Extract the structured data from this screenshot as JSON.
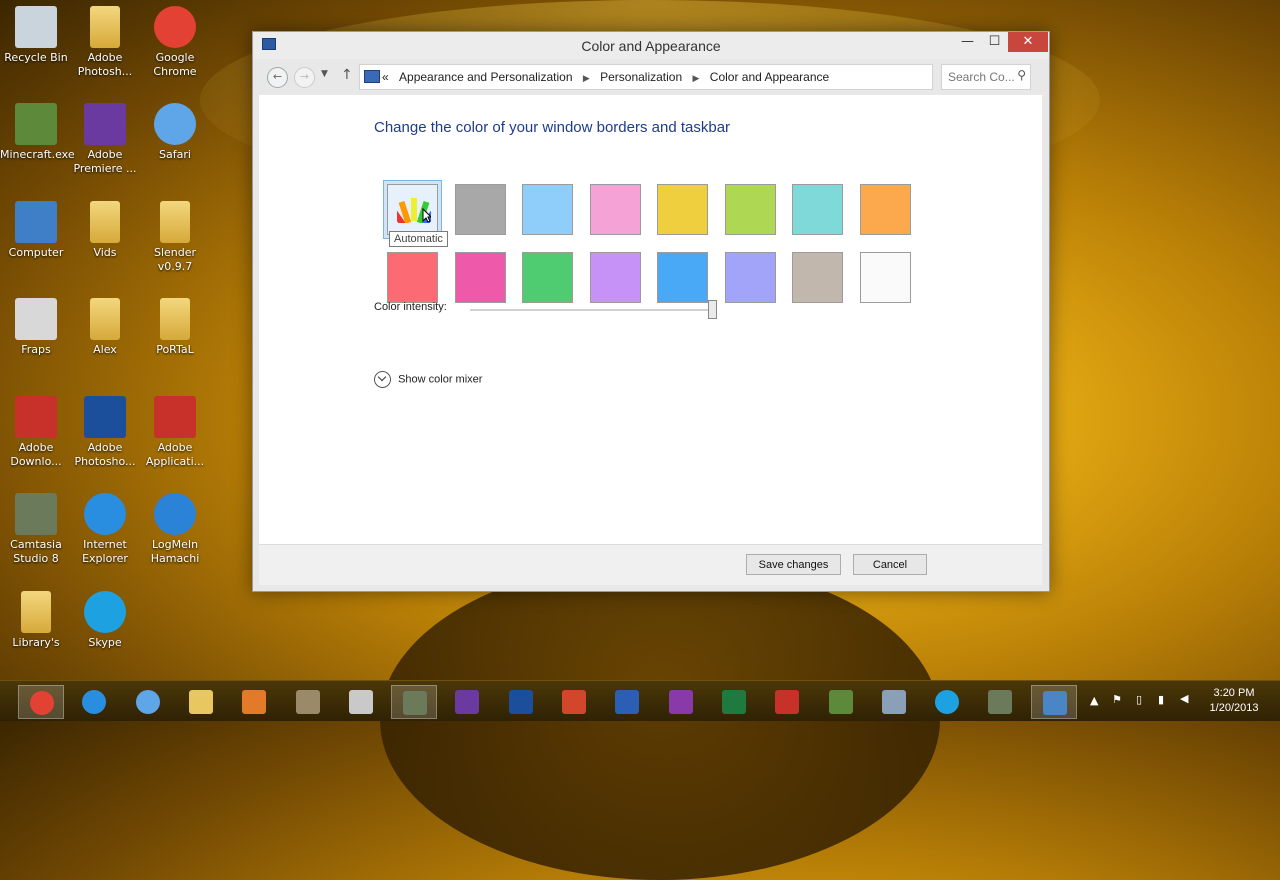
{
  "desktop": {
    "icons": [
      {
        "label": "Recycle Bin",
        "icon": "recycle-bin-icon"
      },
      {
        "label": "Adobe Photosh...",
        "icon": "folder-icon"
      },
      {
        "label": "Google Chrome",
        "icon": "chrome-icon"
      },
      {
        "label": "Minecraft.exe",
        "icon": "minecraft-icon"
      },
      {
        "label": "Adobe Premiere ...",
        "icon": "premiere-icon"
      },
      {
        "label": "Safari",
        "icon": "safari-icon"
      },
      {
        "label": "Computer",
        "icon": "computer-icon"
      },
      {
        "label": "Vids",
        "icon": "folder-icon"
      },
      {
        "label": "Slender v0.9.7",
        "icon": "folder-icon"
      },
      {
        "label": "Fraps",
        "icon": "fraps-icon"
      },
      {
        "label": "Alex",
        "icon": "folder-icon"
      },
      {
        "label": "PoRTaL",
        "icon": "folder-icon"
      },
      {
        "label": "Adobe Downlo...",
        "icon": "adobe-icon"
      },
      {
        "label": "Adobe Photosho...",
        "icon": "photoshop-icon"
      },
      {
        "label": "Adobe Applicati...",
        "icon": "adobe-icon"
      },
      {
        "label": "Camtasia Studio 8",
        "icon": "camtasia-icon"
      },
      {
        "label": "Internet Explorer",
        "icon": "internet-explorer-icon"
      },
      {
        "label": "LogMeIn Hamachi",
        "icon": "hamachi-icon"
      },
      {
        "label": "Library's",
        "icon": "library-icon"
      },
      {
        "label": "Skype",
        "icon": "skype-icon"
      }
    ]
  },
  "window": {
    "title": "Color and Appearance",
    "minimize": "—",
    "maximize": "☐",
    "close": "✕",
    "address": {
      "overflow": "«",
      "crumbs": [
        "Appearance and Personalization",
        "Personalization",
        "Color and Appearance"
      ]
    },
    "search_placeholder": "Search Co...",
    "heading": "Change the color of your window borders and taskbar",
    "swatches_row1": [
      "automatic",
      "#a8a8a8",
      "#8fcdfb",
      "#f5a3d6",
      "#efcf3e",
      "#aed754",
      "#7ed9d8",
      "#fca94e"
    ],
    "swatches_row2": [
      "#fc6b74",
      "#ee5aa9",
      "#4fcb72",
      "#c792f7",
      "#4aa9f6",
      "#a1a4f8",
      "#c2b7ad",
      "#fafafa"
    ],
    "tooltip": "Automatic",
    "intensity_label": "Color intensity:",
    "intensity_value": 1.0,
    "mixer_label": "Show color mixer",
    "save_label": "Save changes",
    "cancel_label": "Cancel"
  },
  "taskbar": {
    "apps": [
      {
        "name": "chrome",
        "color": "#e34133"
      },
      {
        "name": "internet-explorer",
        "color": "#2a8ee0"
      },
      {
        "name": "safari",
        "color": "#5ea6e8"
      },
      {
        "name": "file-explorer",
        "color": "#e8c660"
      },
      {
        "name": "store",
        "color": "#e27a2a"
      },
      {
        "name": "camtasia-recorder",
        "color": "#9a8a6a"
      },
      {
        "name": "fraps",
        "color": "#c9c9c9"
      },
      {
        "name": "camtasia",
        "color": "#6a7a5a"
      },
      {
        "name": "premiere",
        "color": "#6a3aa0"
      },
      {
        "name": "photoshop",
        "color": "#1b4f9c"
      },
      {
        "name": "powerpoint",
        "color": "#d2472b"
      },
      {
        "name": "word",
        "color": "#2b5eb5"
      },
      {
        "name": "onenote",
        "color": "#8a3aa8"
      },
      {
        "name": "excel",
        "color": "#1e7a3e"
      },
      {
        "name": "adobe",
        "color": "#c8302a"
      },
      {
        "name": "minecraft",
        "color": "#5d8a3a"
      },
      {
        "name": "remote-desktop",
        "color": "#8aa0b8"
      },
      {
        "name": "skype",
        "color": "#1ea1e0"
      },
      {
        "name": "camtasia-2",
        "color": "#6a7a5a"
      },
      {
        "name": "control-panel",
        "color": "#4a86c5"
      }
    ],
    "time": "3:20 PM",
    "date": "1/20/2013"
  }
}
